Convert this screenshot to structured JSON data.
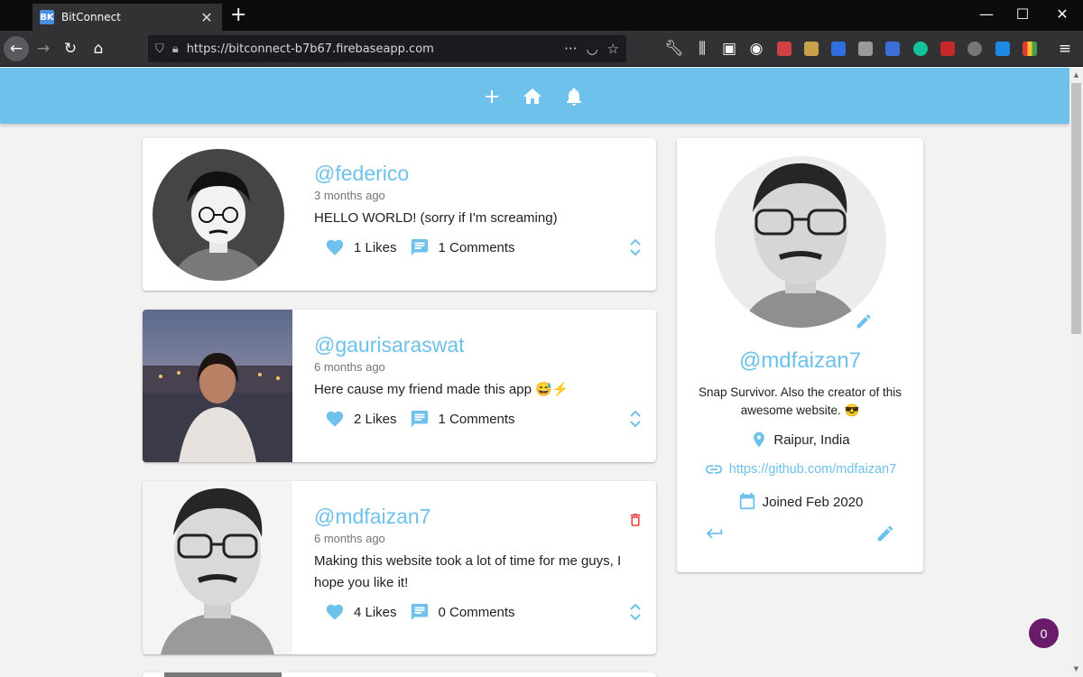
{
  "browser": {
    "tab_title": "BitConnect",
    "favicon_text": "BK",
    "url": "https://bitconnect-b7b67.firebaseapp.com"
  },
  "colors": {
    "primary": "#6ec1ea",
    "delete": "#e53935",
    "fab": "#6a1b6a",
    "text": "#212121",
    "muted": "#757575"
  },
  "header": {
    "icons": [
      "add-icon",
      "home-icon",
      "notifications-icon"
    ]
  },
  "posts": [
    {
      "handle": "@federico",
      "time": "3 months ago",
      "text": "HELLO WORLD! (sorry if I'm screaming)",
      "likes": "1 Likes",
      "comments": "1 Comments",
      "can_delete": false
    },
    {
      "handle": "@gaurisaraswat",
      "time": "6 months ago",
      "text": "Here cause my friend made this app 😅⚡",
      "likes": "2 Likes",
      "comments": "1 Comments",
      "can_delete": false
    },
    {
      "handle": "@mdfaizan7",
      "time": "6 months ago",
      "text": "Making this website took a lot of time for me guys, I hope you like it!",
      "likes": "4 Likes",
      "comments": "0 Comments",
      "can_delete": true
    }
  ],
  "profile": {
    "handle": "@mdfaizan7",
    "bio": "Snap Survivor. Also the creator of this awesome website. 😎",
    "location": "Raipur, India",
    "website": "https://github.com/mdfaizan7",
    "joined": "Joined Feb 2020"
  },
  "fab": {
    "count": "0"
  }
}
